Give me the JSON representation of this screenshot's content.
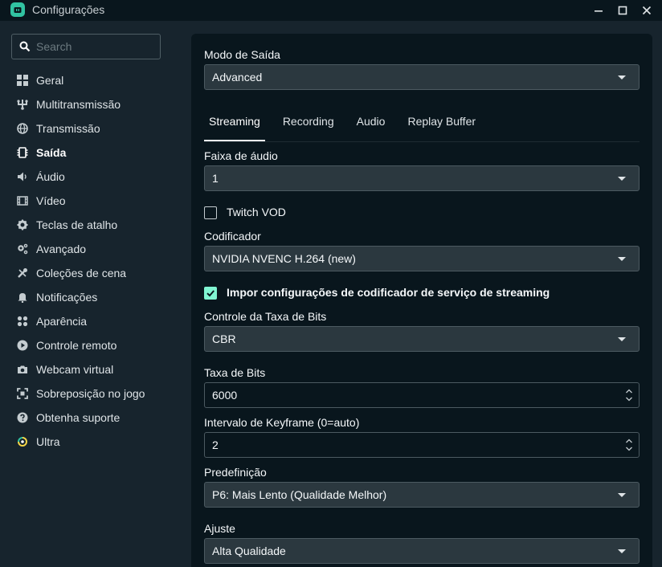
{
  "window": {
    "title": "Configurações",
    "minimize_icon": "minimize-icon",
    "maximize_icon": "maximize-icon",
    "close_icon": "close-icon"
  },
  "colors": {
    "accent": "#80f5d2",
    "app_icon": "#31c3a2",
    "background": "#17242d",
    "panel": "#09161d",
    "field": "#2b383f"
  },
  "sidebar": {
    "search_placeholder": "Search",
    "items": [
      {
        "label": "Geral",
        "icon": "grid-icon"
      },
      {
        "label": "Multitransmissão",
        "icon": "multistream-icon"
      },
      {
        "label": "Transmissão",
        "icon": "globe-icon"
      },
      {
        "label": "Saída",
        "icon": "chip-icon",
        "active": true
      },
      {
        "label": "Áudio",
        "icon": "speaker-icon"
      },
      {
        "label": "Vídeo",
        "icon": "film-icon"
      },
      {
        "label": "Teclas de atalho",
        "icon": "gear-icon"
      },
      {
        "label": "Avançado",
        "icon": "gears-icon"
      },
      {
        "label": "Coleções de cena",
        "icon": "tools-icon"
      },
      {
        "label": "Notificações",
        "icon": "bell-icon"
      },
      {
        "label": "Aparência",
        "icon": "palette-icon"
      },
      {
        "label": "Controle remoto",
        "icon": "play-circle-icon"
      },
      {
        "label": "Webcam virtual",
        "icon": "camera-icon"
      },
      {
        "label": "Sobreposição no jogo",
        "icon": "overlay-icon"
      },
      {
        "label": "Obtenha suporte",
        "icon": "help-icon"
      },
      {
        "label": "Ultra",
        "icon": "ultra-icon"
      }
    ]
  },
  "main": {
    "output_mode": {
      "label": "Modo de Saída",
      "value": "Advanced"
    },
    "tabs": [
      {
        "label": "Streaming",
        "active": true
      },
      {
        "label": "Recording"
      },
      {
        "label": "Audio"
      },
      {
        "label": "Replay Buffer"
      }
    ],
    "audio_track": {
      "label": "Faixa de áudio",
      "value": "1"
    },
    "twitch_vod": {
      "label": "Twitch VOD",
      "checked": false
    },
    "encoder": {
      "label": "Codificador",
      "value": "NVIDIA NVENC H.264 (new)"
    },
    "enforce": {
      "label": "Impor configurações de codificador de serviço de streaming",
      "checked": true
    },
    "rate_control": {
      "label": "Controle da Taxa de Bits",
      "value": "CBR"
    },
    "bitrate": {
      "label": "Taxa de Bits",
      "value": "6000"
    },
    "keyframe": {
      "label": "Intervalo de Keyframe (0=auto)",
      "value": "2"
    },
    "preset": {
      "label": "Predefinição",
      "value": "P6: Mais Lento (Qualidade Melhor)"
    },
    "tuning": {
      "label": "Ajuste",
      "value": "Alta Qualidade"
    }
  }
}
